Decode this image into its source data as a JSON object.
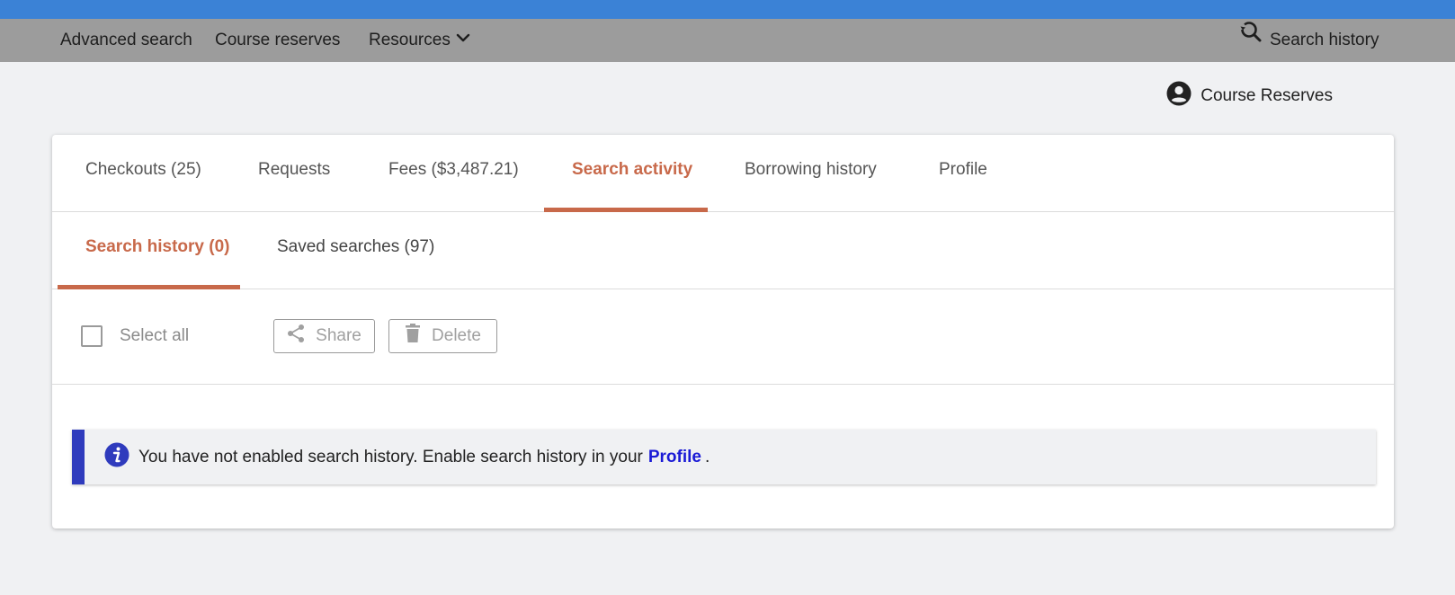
{
  "nav": {
    "advanced_search": "Advanced search",
    "course_reserves": "Course reserves",
    "resources": "Resources",
    "search_history": "Search history"
  },
  "account": {
    "name": "Course Reserves"
  },
  "tabs": [
    {
      "label": "Checkouts (25)",
      "active": false
    },
    {
      "label": "Requests",
      "active": false
    },
    {
      "label": "Fees ($3,487.21)",
      "active": false
    },
    {
      "label": "Search activity",
      "active": true
    },
    {
      "label": "Borrowing history",
      "active": false
    },
    {
      "label": "Profile",
      "active": false
    }
  ],
  "subtabs": [
    {
      "label": "Search history (0)",
      "active": true
    },
    {
      "label": "Saved searches (97)",
      "active": false
    }
  ],
  "toolbar": {
    "select_all": "Select all",
    "select_all_checked": false,
    "share": "Share",
    "delete": "Delete"
  },
  "alert": {
    "message": "You have not enabled search history. Enable search history in your",
    "link": "Profile",
    "suffix": "."
  },
  "colors": {
    "top_bar": "#3b82d6",
    "nav_bar": "#9c9c9c",
    "accent": "#c8694a",
    "alert_border": "#2f3bbd",
    "link": "#1a1ad6"
  }
}
